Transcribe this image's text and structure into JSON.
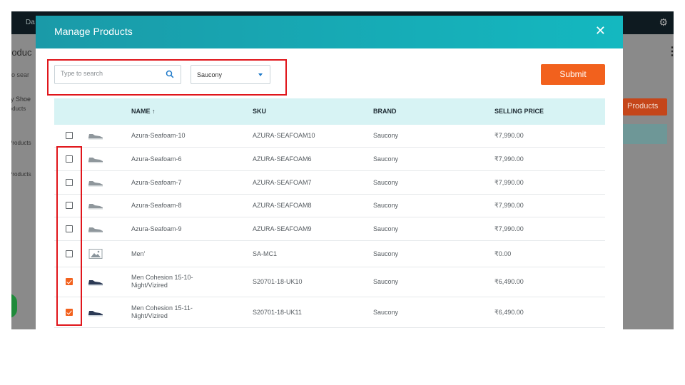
{
  "background": {
    "topbar_text": "Da",
    "page_title": "roduc",
    "search_hint": "e to sear",
    "company": "ny Shoe",
    "side_1": "roducts",
    "side_2": "Products",
    "side_3": "Products",
    "right_button": "Products"
  },
  "modal": {
    "title": "Manage Products",
    "close_label": "✕"
  },
  "search": {
    "placeholder": "Type to search",
    "value": ""
  },
  "brand_filter": {
    "selected": "Saucony"
  },
  "submit_label": "Submit",
  "table": {
    "columns": {
      "name": "NAME ↑",
      "sku": "SKU",
      "brand": "BRAND",
      "price": "SELLING PRICE"
    },
    "rows": [
      {
        "name": "Azura-Seafoam-10",
        "sku": "AZURA-SEAFOAM10",
        "brand": "Saucony",
        "price": "₹7,990.00",
        "checked": false,
        "image": "shoe-grey"
      },
      {
        "name": "Azura-Seafoam-6",
        "sku": "AZURA-SEAFOAM6",
        "brand": "Saucony",
        "price": "₹7,990.00",
        "checked": false,
        "image": "shoe-grey"
      },
      {
        "name": "Azura-Seafoam-7",
        "sku": "AZURA-SEAFOAM7",
        "brand": "Saucony",
        "price": "₹7,990.00",
        "checked": false,
        "image": "shoe-grey"
      },
      {
        "name": "Azura-Seafoam-8",
        "sku": "AZURA-SEAFOAM8",
        "brand": "Saucony",
        "price": "₹7,990.00",
        "checked": false,
        "image": "shoe-grey"
      },
      {
        "name": "Azura-Seafoam-9",
        "sku": "AZURA-SEAFOAM9",
        "brand": "Saucony",
        "price": "₹7,990.00",
        "checked": false,
        "image": "shoe-grey"
      },
      {
        "name": "Men'",
        "sku": "SA-MC1",
        "brand": "Saucony",
        "price": "₹0.00",
        "checked": false,
        "image": "placeholder"
      },
      {
        "name": "Men Cohesion 15-10-Night/Vizired",
        "sku": "S20701-18-UK10",
        "brand": "Saucony",
        "price": "₹6,490.00",
        "checked": true,
        "image": "shoe-navy"
      },
      {
        "name": "Men Cohesion 15-11-Night/Vizired",
        "sku": "S20701-18-UK11",
        "brand": "Saucony",
        "price": "₹6,490.00",
        "checked": true,
        "image": "shoe-navy"
      }
    ]
  },
  "colors": {
    "header_teal": "#14b8c0",
    "accent_orange": "#f2611d",
    "table_header_bg": "#d7f3f4",
    "highlight_red": "#e0151b"
  }
}
